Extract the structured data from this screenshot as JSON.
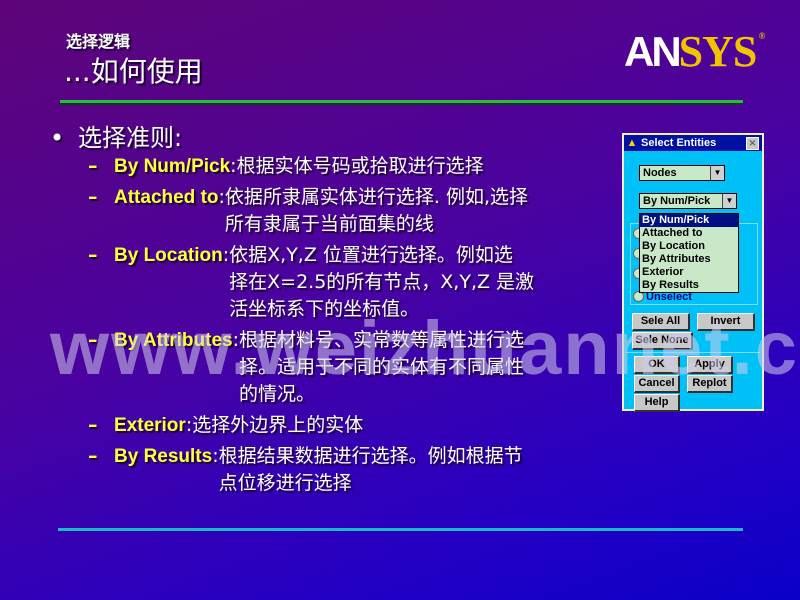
{
  "header": {
    "subtitle": "选择逻辑",
    "title": "...如何使用",
    "logo": {
      "left": "AN",
      "right": "SYS",
      "registered": "®"
    }
  },
  "content": {
    "bullet_symbol": "•",
    "heading": "选择准则:",
    "items": [
      {
        "dash": "–",
        "key": "By Num/Pick",
        "colon": ":",
        "desc": " 根据实体号码或拾取进行选择"
      },
      {
        "dash": "–",
        "key": "Attached to",
        "colon": ":",
        "desc": " 依据所隶属实体进行选择. 例如,选择\n所有隶属于当前面集的线"
      },
      {
        "dash": "–",
        "key": "By Location",
        "colon": ":",
        "desc": " 依据X,Y,Z 位置进行选择。例如选\n择在X=2.5的所有节点，X,Y,Z 是激\n活坐标系下的坐标值。"
      },
      {
        "dash": "–",
        "key": "By Attributes",
        "colon": ":",
        "desc": " 根据材料号、实常数等属性进行选\n择。适用于不同的实体有不同属性\n的情况。"
      },
      {
        "dash": "–",
        "key": "Exterior",
        "colon": ":",
        "desc": "        选择外边界上的实体"
      },
      {
        "dash": "–",
        "key": "By Results",
        "colon": ":",
        "desc": " 根据结果数据进行选择。例如根据节\n点位移进行选择"
      }
    ]
  },
  "watermark": "www.weizhuannet.com",
  "dialog": {
    "title": "Select Entities",
    "entity_select": {
      "value": "Nodes"
    },
    "criterion_select": {
      "value": "By Num/Pick",
      "options": [
        "By Num/Pick",
        "Attached to",
        "By Location",
        "By Attributes",
        "Exterior",
        "By Results"
      ],
      "selected_index": 0
    },
    "unselect_label": "Unselect",
    "buttons": {
      "sele_all": "Sele All",
      "invert": "Invert",
      "sele_none": "Sele None",
      "ok": "OK",
      "apply": "Apply",
      "cancel": "Cancel",
      "replot": "Replot",
      "help": "Help"
    }
  }
}
